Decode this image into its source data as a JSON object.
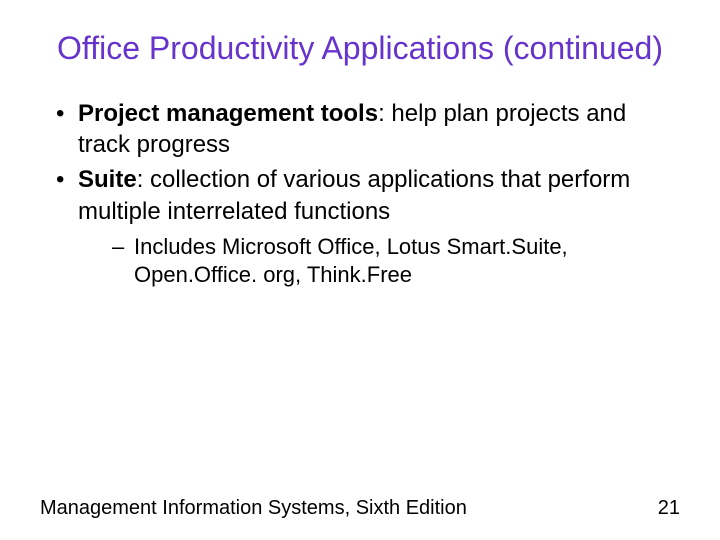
{
  "title": "Office Productivity Applications (continued)",
  "bullets": [
    {
      "bold": "Project management tools",
      "rest": ": help plan projects and track progress"
    },
    {
      "bold": "Suite",
      "rest": ": collection of various applications that perform multiple interrelated functions"
    }
  ],
  "subitem": "Includes Microsoft Office, Lotus Smart.Suite, Open.Office. org, Think.Free",
  "footer": {
    "left": "Management Information Systems, Sixth Edition",
    "right": "21"
  }
}
